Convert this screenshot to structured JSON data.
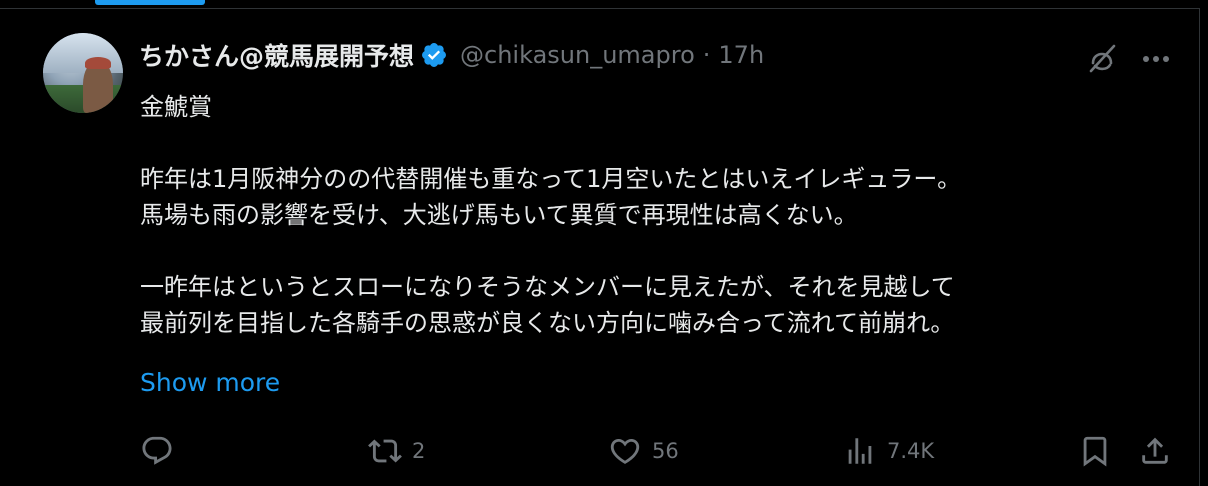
{
  "tweet": {
    "display_name": "ちかさん@競馬展開予想",
    "handle": "@chikasun_umapro",
    "separator": "·",
    "time": "17h",
    "verified": true,
    "text_lines": {
      "l1": "金鯱賞",
      "l2": "昨年は1月阪神分のの代替開催も重なって1月空いたとはいえイレギュラー。",
      "l3": "馬場も雨の影響を受け、大逃げ馬もいて異質で再現性は高くない。",
      "l4": "一昨年はというとスローになりそうなメンバーに見えたが、それを見越して",
      "l5": "最前列を目指した各騎手の思惑が良くない方向に噛み合って流れて前崩れ。"
    },
    "show_more": "Show more",
    "actions": {
      "replies": "",
      "retweets": "2",
      "likes": "56",
      "views": "7.4K"
    }
  },
  "colors": {
    "background": "#000000",
    "text": "#e7e9ea",
    "secondary": "#71767b",
    "accent": "#1d9bf0",
    "border": "#2f3336"
  },
  "icons": {
    "verified": "verified-badge-icon",
    "grok": "grok-icon",
    "more": "more-icon",
    "reply": "reply-icon",
    "retweet": "retweet-icon",
    "like": "heart-icon",
    "views": "views-icon",
    "bookmark": "bookmark-icon",
    "share": "share-icon"
  }
}
